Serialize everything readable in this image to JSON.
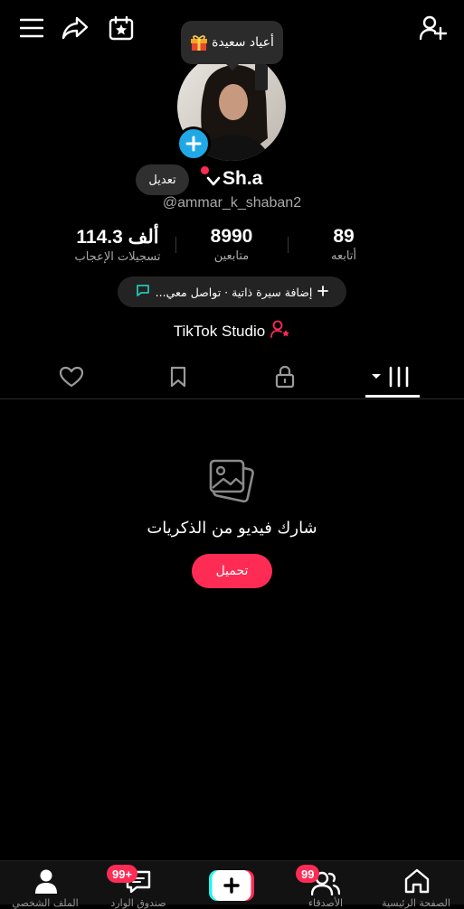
{
  "tooltip": {
    "text": "أعياد سعيدة"
  },
  "profile": {
    "display_name": "Sh.a",
    "handle": "@ammar_k_shaban2",
    "edit_label": "تعديل"
  },
  "stats": [
    {
      "value": "114.3 ألف",
      "label": "تسجيلات الإعجاب"
    },
    {
      "value": "8990",
      "label": "متابعين"
    },
    {
      "value": "89",
      "label": "أتابعه"
    }
  ],
  "bio_button": {
    "text": "إضافة سيرة ذاتية · تواصل معي..."
  },
  "studio": {
    "label": "TikTok Studio"
  },
  "empty_state": {
    "title": "شارك فيديو من الذكريات",
    "button_label": "تحميل"
  },
  "bottom_nav": {
    "inbox_badge": "99+",
    "friends_badge": "99",
    "items": [
      {
        "label": "الملف الشخصي"
      },
      {
        "label": "صندوق الوارد"
      },
      {
        "label": ""
      },
      {
        "label": "الأصدقاء"
      },
      {
        "label": "الصفحة الرئيسية"
      }
    ]
  },
  "colors": {
    "accent": "#fe2c55",
    "avatar_add": "#20a8e6",
    "chat_icon": "#25c4b4"
  }
}
